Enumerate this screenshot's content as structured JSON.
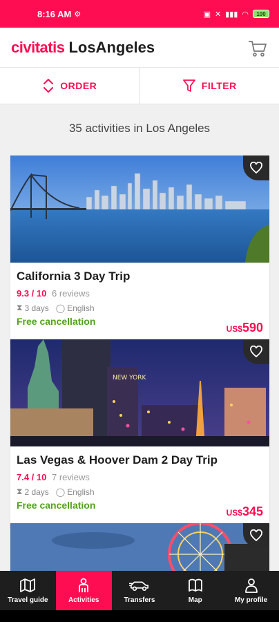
{
  "status": {
    "time": "8:16 AM",
    "battery": "100"
  },
  "header": {
    "logo": "civitatis",
    "city": "LosAngeles"
  },
  "toolbar": {
    "order_label": "ORDER",
    "filter_label": "FILTER"
  },
  "results": {
    "count_text": "35 activities in Los Angeles"
  },
  "activities": [
    {
      "title": "California 3 Day Trip",
      "score": "9.3 / 10",
      "reviews": "6  reviews",
      "duration": "3 days",
      "language": "English",
      "cancellation": "Free cancellation",
      "currency": "US$",
      "price": "590"
    },
    {
      "title": "Las Vegas & Hoover Dam 2 Day Trip",
      "score": "7.4 / 10",
      "reviews": "7  reviews",
      "duration": "2 days",
      "language": "English",
      "cancellation": "Free cancellation",
      "currency": "US$",
      "price": "345"
    }
  ],
  "nav": [
    {
      "label": "Travel guide",
      "icon": "map-icon"
    },
    {
      "label": "Activities",
      "icon": "person-icon",
      "active": true
    },
    {
      "label": "Transfers",
      "icon": "car-icon"
    },
    {
      "label": "Map",
      "icon": "fold-map-icon"
    },
    {
      "label": "My profile",
      "icon": "profile-icon"
    }
  ],
  "colors": {
    "brand": "#ff0d52",
    "green": "#52a31a",
    "nav_bg": "#1e1e1e"
  }
}
